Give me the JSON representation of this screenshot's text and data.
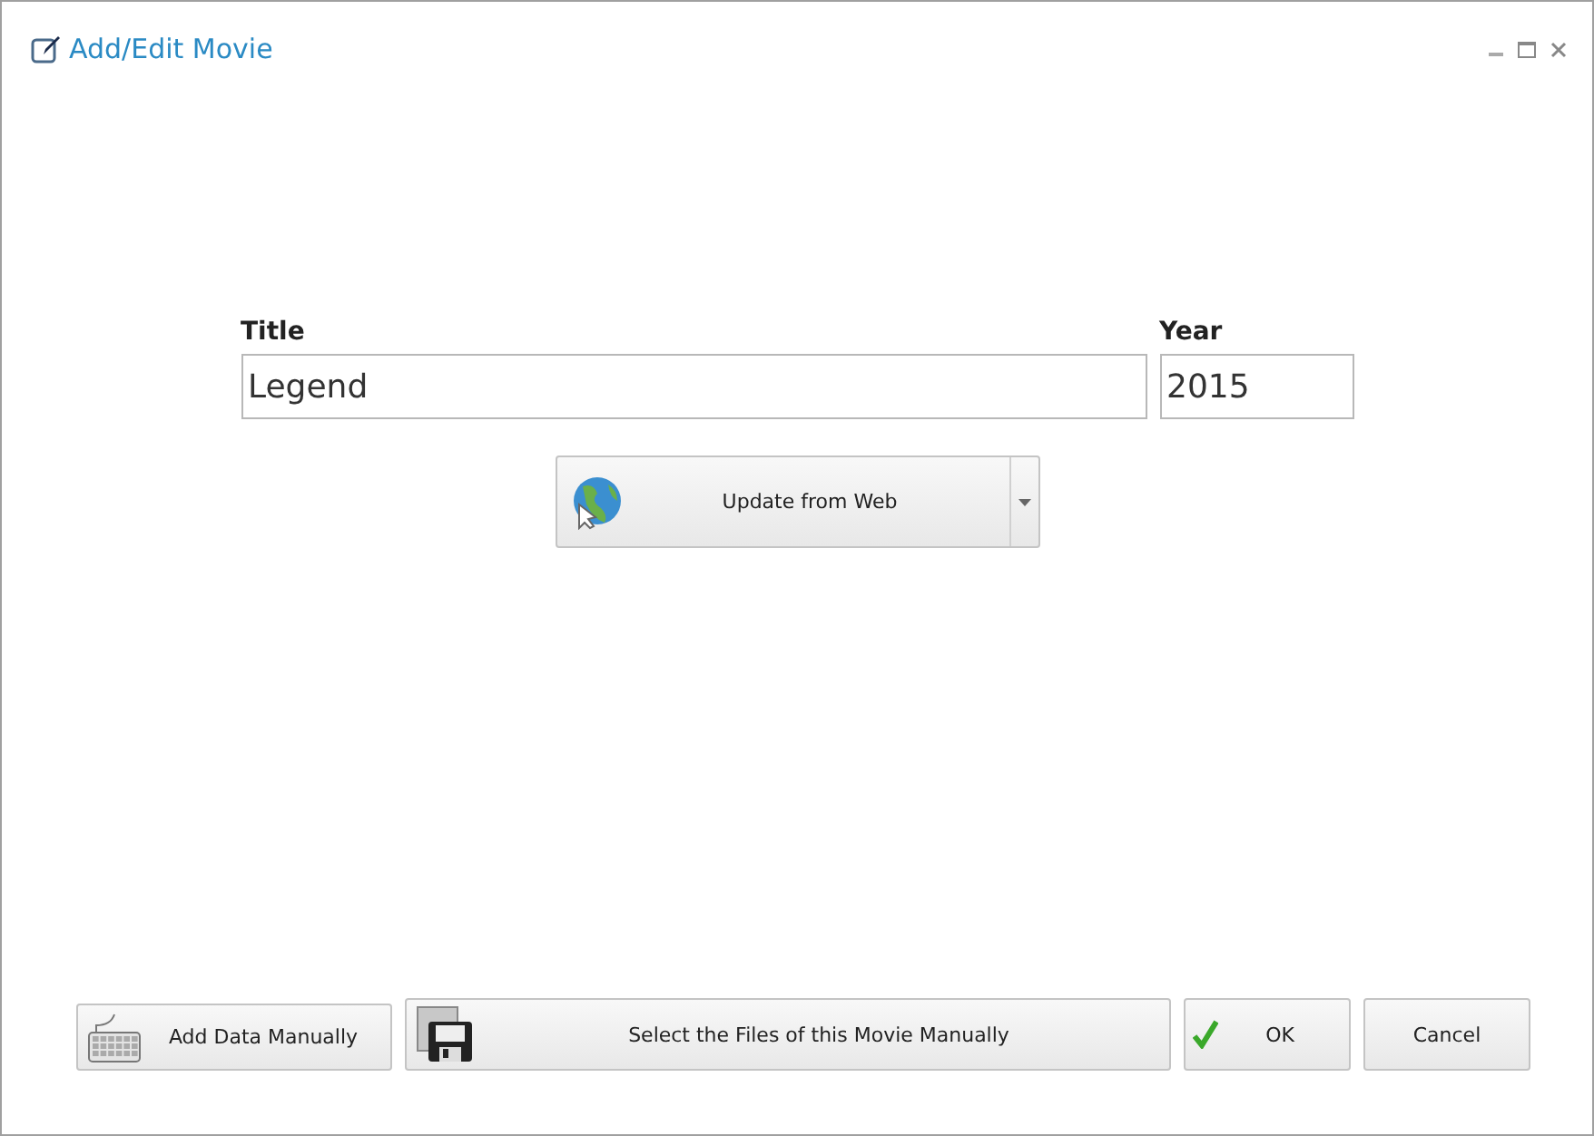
{
  "window": {
    "title": "Add/Edit Movie"
  },
  "form": {
    "title_label": "Title",
    "title_value": "Legend",
    "year_label": "Year",
    "year_value": "2015"
  },
  "update_button": {
    "label": "Update from Web"
  },
  "buttons": [
    {
      "kind": "keyboard",
      "label": "Add Data Manually"
    },
    {
      "kind": "disk",
      "label": "Select the Files of this Movie Manually"
    },
    {
      "kind": "ok",
      "label": "OK"
    },
    {
      "kind": "cancel",
      "label": "Cancel"
    }
  ]
}
